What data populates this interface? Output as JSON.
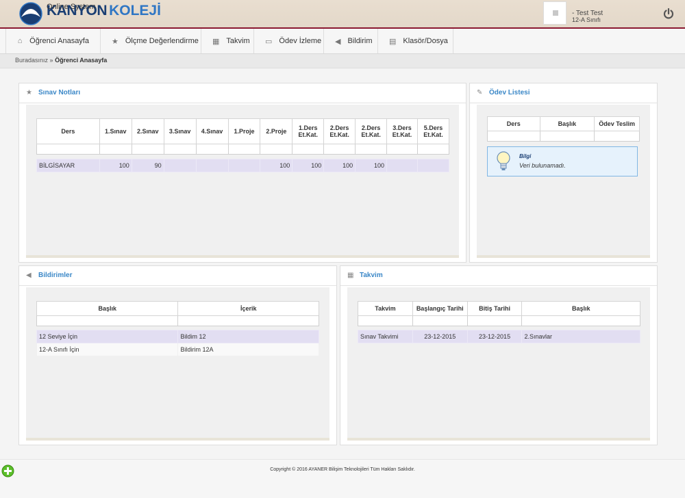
{
  "header": {
    "brand_name_1": "KANYON",
    "brand_name_2": "KOLEJİ",
    "brand_subtitle": "Online System",
    "user_name": "- Test Test",
    "user_class": "12-A Sınıfı"
  },
  "nav": {
    "items": [
      {
        "label": "Öğrenci Anasayfa",
        "icon": "home-icon"
      },
      {
        "label": "Ölçme Değerlendirme",
        "icon": "star-icon"
      },
      {
        "label": "Takvim",
        "icon": "calendar-icon"
      },
      {
        "label": "Ödev İzleme",
        "icon": "monitor-icon"
      },
      {
        "label": "Bildirim",
        "icon": "megaphone-icon"
      },
      {
        "label": "Klasör/Dosya",
        "icon": "folder-icon"
      }
    ]
  },
  "breadcrumb": {
    "prefix": "Buradasınız »",
    "current": "Öğrenci Anasayfa"
  },
  "sinav": {
    "title": "Sınav Notları",
    "headers": [
      "Ders",
      "1.Sınav",
      "2.Sınav",
      "3.Sınav",
      "4.Sınav",
      "1.Proje",
      "2.Proje",
      "1.Ders Et.Kat.",
      "2.Ders Et.Kat.",
      "2.Ders Et.Kat.",
      "3.Ders Et.Kat.",
      "5.Ders Et.Kat."
    ],
    "rows": [
      [
        "BİLGİSAYAR",
        "100",
        "90",
        "",
        "",
        "",
        "100",
        "100",
        "100",
        "100",
        "",
        ""
      ]
    ]
  },
  "odev": {
    "title": "Ödev Listesi",
    "headers": [
      "Ders",
      "Başlık",
      "Ödev Teslim"
    ],
    "info_title": "Bilgi",
    "info_message": "Veri bulunamadı."
  },
  "bildirim": {
    "title": "Bildirimler",
    "headers": [
      "Başlık",
      "İçerik"
    ],
    "rows": [
      [
        "12 Seviye İçin",
        "Bildim 12"
      ],
      [
        "12-A Sınıfı İçin",
        "Bildirim 12A"
      ]
    ]
  },
  "takvim": {
    "title": "Takvim",
    "headers": [
      "Takvim",
      "Başlangıç Tarihi",
      "Bitiş Tarihi",
      "Başlık"
    ],
    "rows": [
      [
        "Sınav Takvimi",
        "23-12-2015",
        "23-12-2015",
        "2.Sınavlar"
      ]
    ]
  },
  "footer": {
    "copyright": "Copyright © 2016 AYANER Bilişim Teknolojileri Tüm Hakları Saklıdır."
  },
  "colors": {
    "brand_dark": "#1a3e73",
    "brand_light": "#2f76c4",
    "header_border": "#8a1830",
    "panel_title": "#3a87c7",
    "row_highlight": "#e2def2"
  }
}
